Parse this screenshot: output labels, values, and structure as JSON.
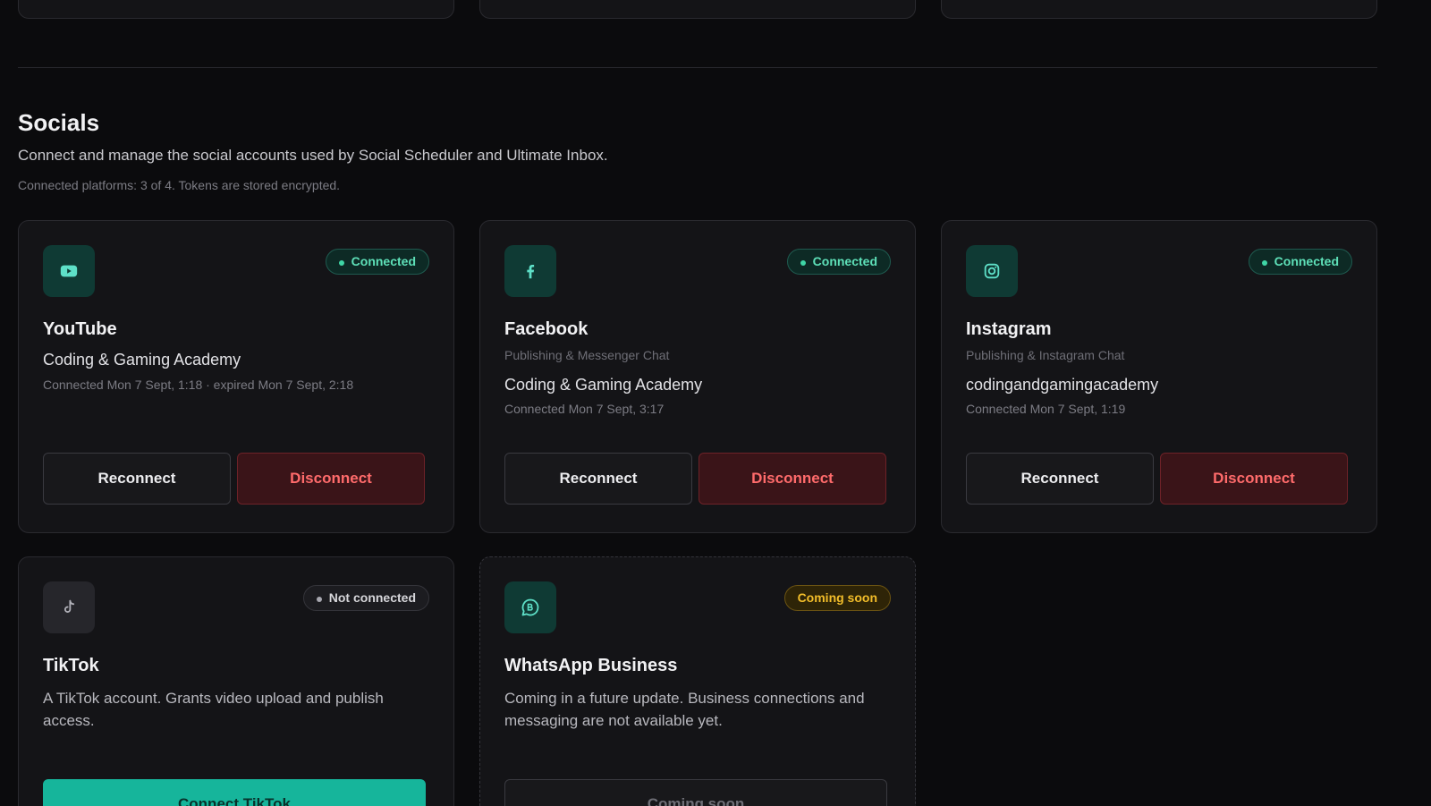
{
  "section": {
    "title": "Socials",
    "subtitle": "Connect and manage the social accounts used by Social Scheduler and Ultimate Inbox.",
    "meta": "Connected platforms: 3 of 4. Tokens are stored encrypted."
  },
  "colors": {
    "accent": "#16b59b",
    "connected": "#3fd6a6",
    "danger": "#ff6b6b",
    "warning": "#f2bd2a"
  },
  "platforms": [
    {
      "name": "YouTube",
      "icon": "youtube-icon",
      "status": "Connected",
      "account": "Coding & Gaming Academy",
      "connected_at": "Connected Mon 7 Sept, 1:18 · expired Mon 7 Sept, 2:18",
      "reconnect_label": "Reconnect",
      "disconnect_label": "Disconnect"
    },
    {
      "name": "Facebook",
      "icon": "facebook-icon",
      "status": "Connected",
      "capabilities": "Publishing & Messenger Chat",
      "account": "Coding & Gaming Academy",
      "connected_at": "Connected Mon 7 Sept, 3:17",
      "reconnect_label": "Reconnect",
      "disconnect_label": "Disconnect"
    },
    {
      "name": "Instagram",
      "icon": "instagram-icon",
      "status": "Connected",
      "capabilities": "Publishing & Instagram Chat",
      "account": "codingandgamingacademy",
      "connected_at": "Connected Mon 7 Sept, 1:19",
      "reconnect_label": "Reconnect",
      "disconnect_label": "Disconnect"
    },
    {
      "name": "TikTok",
      "icon": "tiktok-icon",
      "status": "Not connected",
      "description": "A TikTok account. Grants video upload and publish access.",
      "connect_label": "Connect TikTok"
    },
    {
      "name": "WhatsApp Business",
      "icon": "whatsapp-icon",
      "status": "Coming soon",
      "description": "Coming in a future update. Business connections and messaging are not available yet.",
      "action_label": "Coming soon"
    }
  ]
}
